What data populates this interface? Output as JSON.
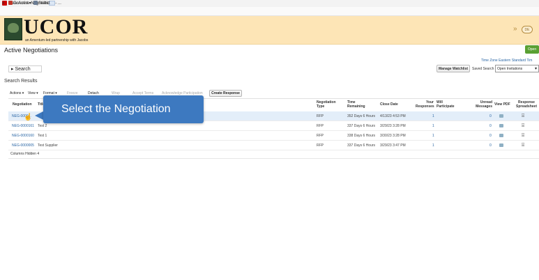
{
  "browser": {
    "tab_title": "View Active Negotiations - ...",
    "tab_close": "×",
    "cmd_close": "x",
    "convert_label": "Convert",
    "convert_arrow": "▾",
    "select_label": "Select"
  },
  "banner": {
    "logo_text": "UCOR",
    "logo_sub": "an Amentum-led partnership with Jacobs",
    "user_initials": "DE"
  },
  "page": {
    "title": "Active Negotiations",
    "open_button": "Open",
    "timezone": "Time Zone Eastern Standard Tim",
    "search_header": "Search",
    "search_caret": "▸",
    "manage_watchlist": "Manage Watchlist",
    "saved_search_label": "Saved Search",
    "saved_search_value": "Open Invitations",
    "saved_search_arrow": "▾",
    "results_title": "Search Results",
    "columns_hidden": "Columns Hidden  4"
  },
  "toolbar": {
    "actions": "Actions ▾",
    "view": "View ▾",
    "format": "Format ▾",
    "freeze": "Freeze",
    "detach": "Detach",
    "wrap": "Wrap",
    "accept_terms": "Accept Terms",
    "acknowledge": "Acknowledge Participation",
    "create_response": "Create Response"
  },
  "columns": {
    "negotiation": "Negotiation",
    "title": "Title",
    "type": "Negotiation Type",
    "remaining": "Time Remaining",
    "close_date": "Close Date",
    "your_responses": "Your Responses",
    "will_participate": "Will Participate",
    "unread": "Unread Messages",
    "view_pdf": "View PDF",
    "response_sheet": "Response Spreadsheet"
  },
  "rows": [
    {
      "negotiation": "NEG-0000...",
      "title": "",
      "type": "RFP",
      "remaining": "352 Days 6 Hours",
      "close_date": "4/13/23 4:53 PM",
      "responses": "1",
      "unread": "0"
    },
    {
      "negotiation": "NEG-0000161",
      "title": "Test 2",
      "type": "RFP",
      "remaining": "337 Days 6 Hours",
      "close_date": "3/29/23 3:28 PM",
      "responses": "1",
      "unread": "0"
    },
    {
      "negotiation": "NEG-0000160",
      "title": "Test 1",
      "type": "RFP",
      "remaining": "338 Days 6 Hours",
      "close_date": "3/30/23 3:28 PM",
      "responses": "1",
      "unread": "0"
    },
    {
      "negotiation": "NEG-0000005",
      "title": "Test Supplier",
      "type": "RFP",
      "remaining": "337 Days 6 Hours",
      "close_date": "3/29/23 3:47 PM",
      "responses": "1",
      "unread": "0"
    }
  ],
  "callout": {
    "text": "Select the Negotiation"
  },
  "colors": {
    "banner": "#fde5b6",
    "callout": "#3d79c0",
    "link": "#2a66a5",
    "open_button": "#5aa033"
  },
  "icons": {
    "pdf": "pdf-icon",
    "spreadsheet": "spreadsheet-icon",
    "cursor": "hand-cursor-icon"
  }
}
